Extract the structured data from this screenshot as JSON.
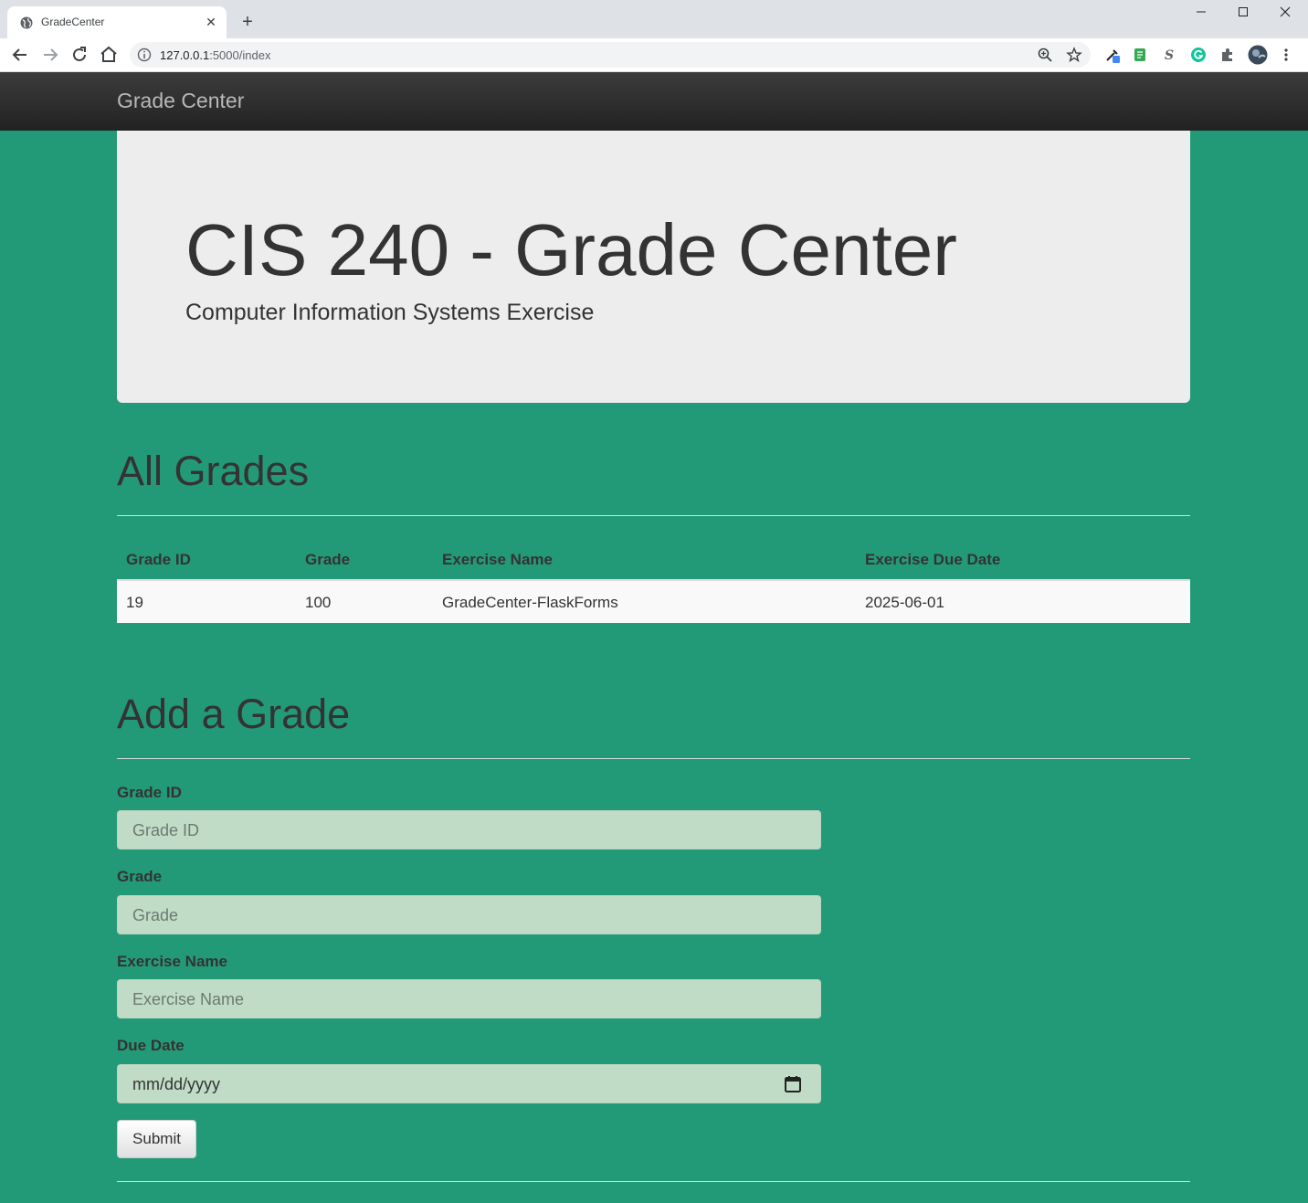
{
  "browser": {
    "tab_title": "GradeCenter",
    "tab_close": "✕",
    "new_tab": "+",
    "url_host": "127.0.0.1",
    "url_path": ":5000/index",
    "window_minimize": "—",
    "window_maximize": "☐",
    "window_close": "✕"
  },
  "navbar": {
    "brand": "Grade Center"
  },
  "jumbotron": {
    "title": "CIS 240 - Grade Center",
    "subtitle": "Computer Information Systems Exercise"
  },
  "grades_section": {
    "title": "All Grades",
    "columns": [
      "Grade ID",
      "Grade",
      "Exercise Name",
      "Exercise Due Date"
    ],
    "rows": [
      [
        "19",
        "100",
        "GradeCenter-FlaskForms",
        "2025-06-01"
      ]
    ]
  },
  "add_section": {
    "title": "Add a Grade",
    "fields": [
      {
        "label": "Grade ID",
        "placeholder": "Grade ID",
        "value": ""
      },
      {
        "label": "Grade",
        "placeholder": "Grade",
        "value": ""
      },
      {
        "label": "Exercise Name",
        "placeholder": "Exercise Name",
        "value": ""
      },
      {
        "label": "Due Date",
        "placeholder": "mm/dd/yyyy",
        "value": ""
      }
    ],
    "submit_label": "Submit"
  },
  "colors": {
    "page_background": "#239a77",
    "navbar": "#2b2b2b",
    "jumbotron": "#ededed",
    "input_background": "#c0dcc7"
  }
}
